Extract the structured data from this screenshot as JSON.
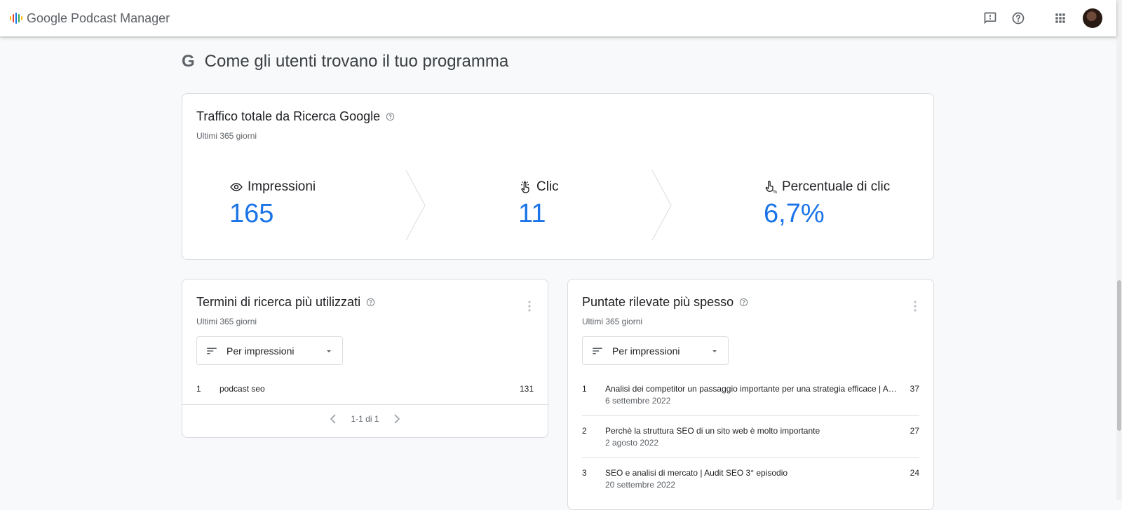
{
  "app": {
    "title": "Google Podcast Manager"
  },
  "colors": {
    "accent": "#1a73e8",
    "logo": [
      "#fbbc04",
      "#ea4335",
      "#1a73e8",
      "#34a853"
    ]
  },
  "icons": {
    "feedback": "feedback-icon",
    "help": "help-icon",
    "apps": "apps-grid-icon",
    "avatar": "account-avatar"
  },
  "section": {
    "title": "Come gli utenti trovano il tuo programma",
    "mark": "G"
  },
  "traffic": {
    "title": "Traffico totale da Ricerca Google",
    "period": "Ultimi 365 giorni",
    "metrics": [
      {
        "label": "Impressioni",
        "value": "165",
        "icon": "eye-icon"
      },
      {
        "label": "Clic",
        "value": "11",
        "icon": "click-icon"
      },
      {
        "label": "Percentuale di clic",
        "value": "6,7%",
        "icon": "click-rate-icon"
      }
    ]
  },
  "terms": {
    "title": "Termini di ricerca più utilizzati",
    "period": "Ultimi 365 giorni",
    "sort_label": "Per impressioni",
    "rows": [
      {
        "rank": "1",
        "term": "podcast seo",
        "value": "131"
      }
    ],
    "pager": "1-1 di 1"
  },
  "episodes": {
    "title": "Puntate rilevate più spesso",
    "period": "Ultimi 365 giorni",
    "sort_label": "Per impressioni",
    "rows": [
      {
        "rank": "1",
        "title": "Analisi dei competitor un passaggio importante per una strategia efficace | Audit SEO",
        "date": "6 settembre 2022",
        "value": "37"
      },
      {
        "rank": "2",
        "title": "Perchè la struttura SEO di un sito web è molto importante",
        "date": "2 agosto 2022",
        "value": "27"
      },
      {
        "rank": "3",
        "title": "SEO e analisi di mercato | Audit SEO 3° episodio",
        "date": "20 settembre 2022",
        "value": "24"
      }
    ]
  }
}
